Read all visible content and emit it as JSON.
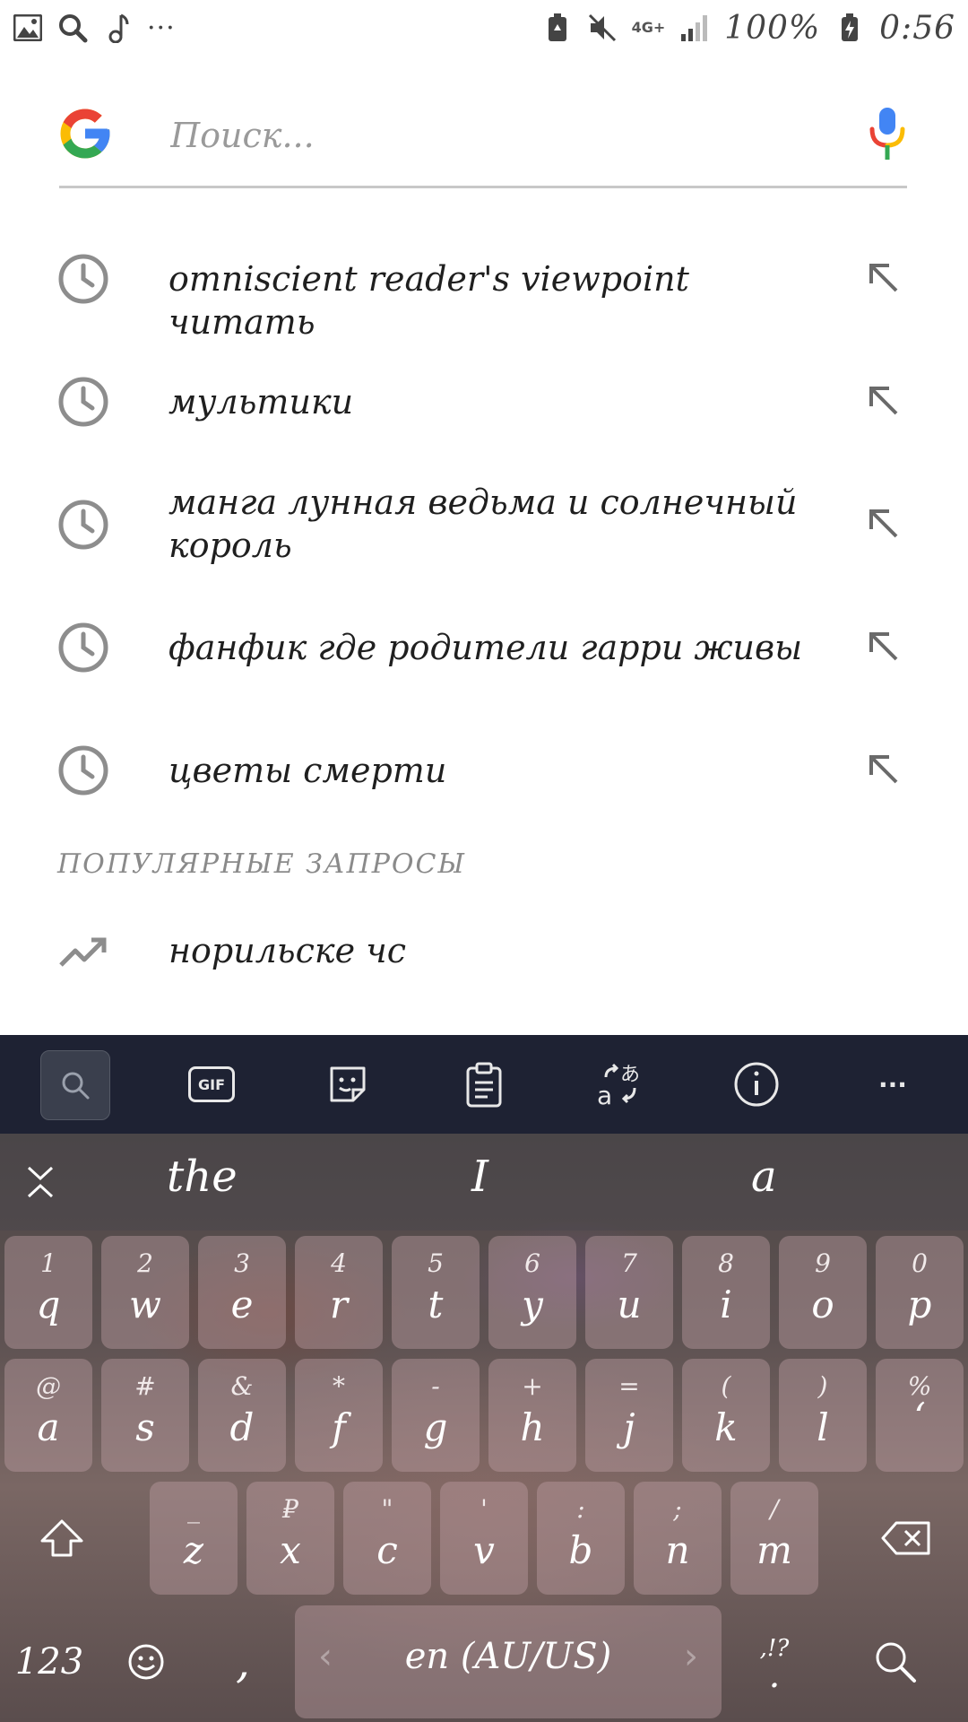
{
  "status_bar": {
    "network": "4G+",
    "battery": "100%",
    "time": "0:56",
    "more": "···"
  },
  "search": {
    "placeholder": "Поиск..."
  },
  "history": [
    {
      "text": "omniscient reader's viewpoint читать"
    },
    {
      "text": "мультики"
    },
    {
      "text": "манга лунная ведьма и солнечный король"
    },
    {
      "text": "фанфик где родители гарри живы"
    },
    {
      "text": "цветы смерти"
    }
  ],
  "popular": {
    "header": "ПОПУЛЯРНЫЕ ЗАПРОСЫ",
    "items": [
      {
        "text": "норильске чс"
      }
    ]
  },
  "keyboard": {
    "toolbar": {
      "gif_label": "GIF",
      "more_label": "···"
    },
    "suggestions": [
      "the",
      "I",
      "a"
    ],
    "row1": [
      {
        "hint": "1",
        "key": "q"
      },
      {
        "hint": "2",
        "key": "w"
      },
      {
        "hint": "3",
        "key": "e"
      },
      {
        "hint": "4",
        "key": "r"
      },
      {
        "hint": "5",
        "key": "t"
      },
      {
        "hint": "6",
        "key": "y"
      },
      {
        "hint": "7",
        "key": "u"
      },
      {
        "hint": "8",
        "key": "i"
      },
      {
        "hint": "9",
        "key": "o"
      },
      {
        "hint": "0",
        "key": "p"
      }
    ],
    "row2": [
      {
        "hint": "@",
        "key": "a"
      },
      {
        "hint": "#",
        "key": "s"
      },
      {
        "hint": "&",
        "key": "d"
      },
      {
        "hint": "*",
        "key": "f"
      },
      {
        "hint": "-",
        "key": "g"
      },
      {
        "hint": "+",
        "key": "h"
      },
      {
        "hint": "=",
        "key": "j"
      },
      {
        "hint": "(",
        "key": "k"
      },
      {
        "hint": ")",
        "key": "l"
      },
      {
        "hint": "%",
        "key": "‘"
      }
    ],
    "row3": [
      {
        "hint": "_",
        "key": "z"
      },
      {
        "hint": "₽",
        "key": "x"
      },
      {
        "hint": "\"",
        "key": "c"
      },
      {
        "hint": "'",
        "key": "v"
      },
      {
        "hint": ":",
        "key": "b"
      },
      {
        "hint": ";",
        "key": "n"
      },
      {
        "hint": "/",
        "key": "m"
      }
    ],
    "bottom": {
      "numbers_label": "123",
      "comma_label": ",",
      "language_label": "en (AU/US)",
      "punct_hint": ",!?",
      "punct_key": "."
    }
  },
  "colors": {
    "toolbar_bg": "#1e2233",
    "clock_icon": "#8d8d8d",
    "google_blue": "#4285F4",
    "google_red": "#EA4335",
    "google_yellow": "#FBBC05",
    "google_green": "#34A853"
  }
}
